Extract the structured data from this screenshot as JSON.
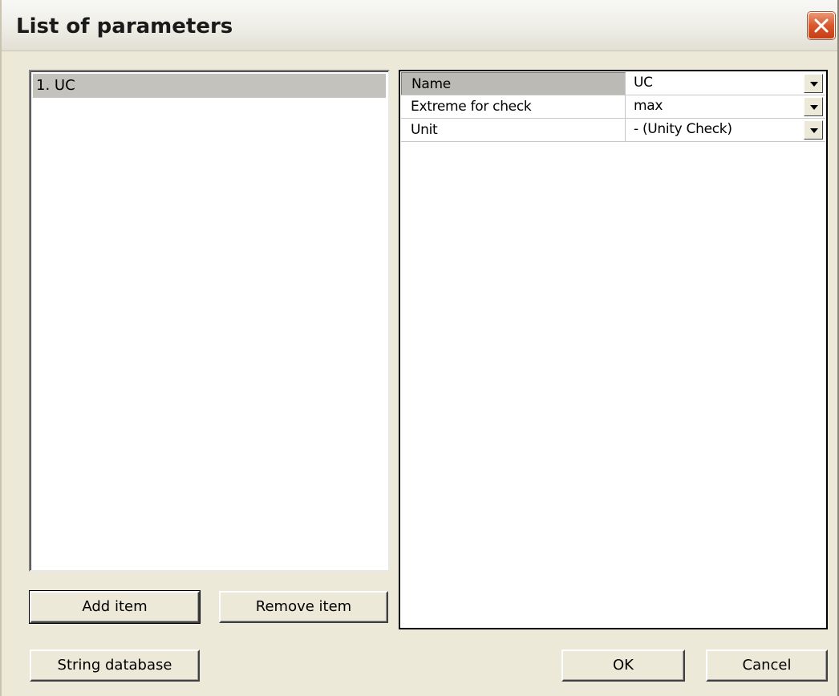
{
  "window": {
    "title": "List of parameters",
    "close_icon": "close-x-icon"
  },
  "list": {
    "items": [
      {
        "label": "1. UC",
        "selected": true
      }
    ]
  },
  "buttons": {
    "add_item": "Add item",
    "remove_item": "Remove item",
    "string_database": "String database",
    "ok": "OK",
    "cancel": "Cancel"
  },
  "properties": {
    "rows": [
      {
        "name": "Name",
        "value": "UC"
      },
      {
        "name": "Extreme for check",
        "value": "max"
      },
      {
        "name": "Unit",
        "value": "- (Unity Check)"
      }
    ]
  },
  "colors": {
    "dialog_bg": "#ece9d8",
    "selection_bg": "#c4c2bd",
    "close_button": "#d9572c"
  }
}
